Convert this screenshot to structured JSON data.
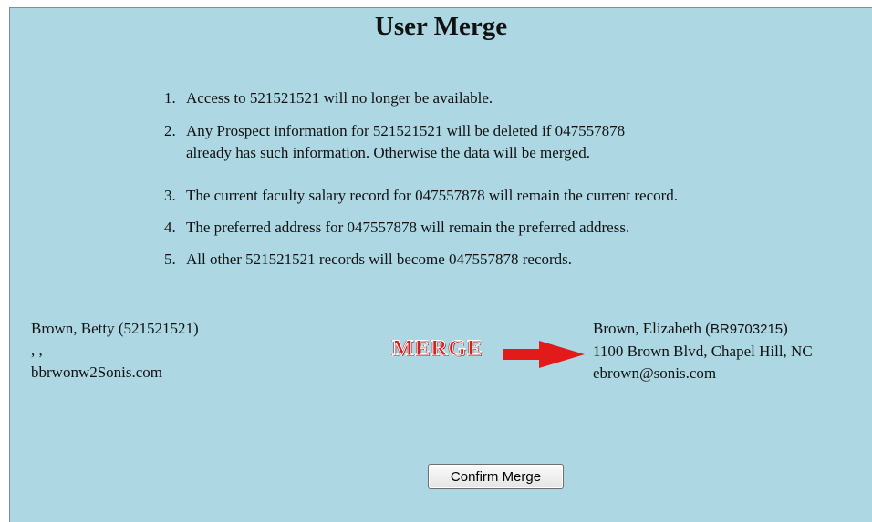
{
  "title": "User Merge",
  "items": [
    {
      "number": "1.",
      "text": "Access to 521521521 will no longer be available."
    },
    {
      "number": "2.",
      "text": "Any Prospect information for 521521521 will be deleted if 047557878",
      "continuation": "already has such information. Otherwise the data will be merged."
    },
    {
      "number": "3.",
      "text": "The current faculty salary record for 047557878 will remain the current record."
    },
    {
      "number": "4.",
      "text": "The preferred address for 047557878 will remain the preferred address."
    },
    {
      "number": "5.",
      "text": "All other 521521521 records will become 047557878 records."
    }
  ],
  "source_user": {
    "name": "Brown, Betty (521521521)",
    "address": ", ,",
    "email": "bbrwonw2Sonis.com"
  },
  "target_user": {
    "name": "Brown, Elizabeth (",
    "id": "BR9703215",
    "name_suffix": ")",
    "address": "1100 Brown Blvd, Chapel Hill, NC",
    "email": "ebrown@sonis.com"
  },
  "merge_label": "MERGE",
  "confirm_button_label": "Confirm Merge",
  "colors": {
    "background": "#add8e3",
    "arrow": "#e21a1a"
  }
}
